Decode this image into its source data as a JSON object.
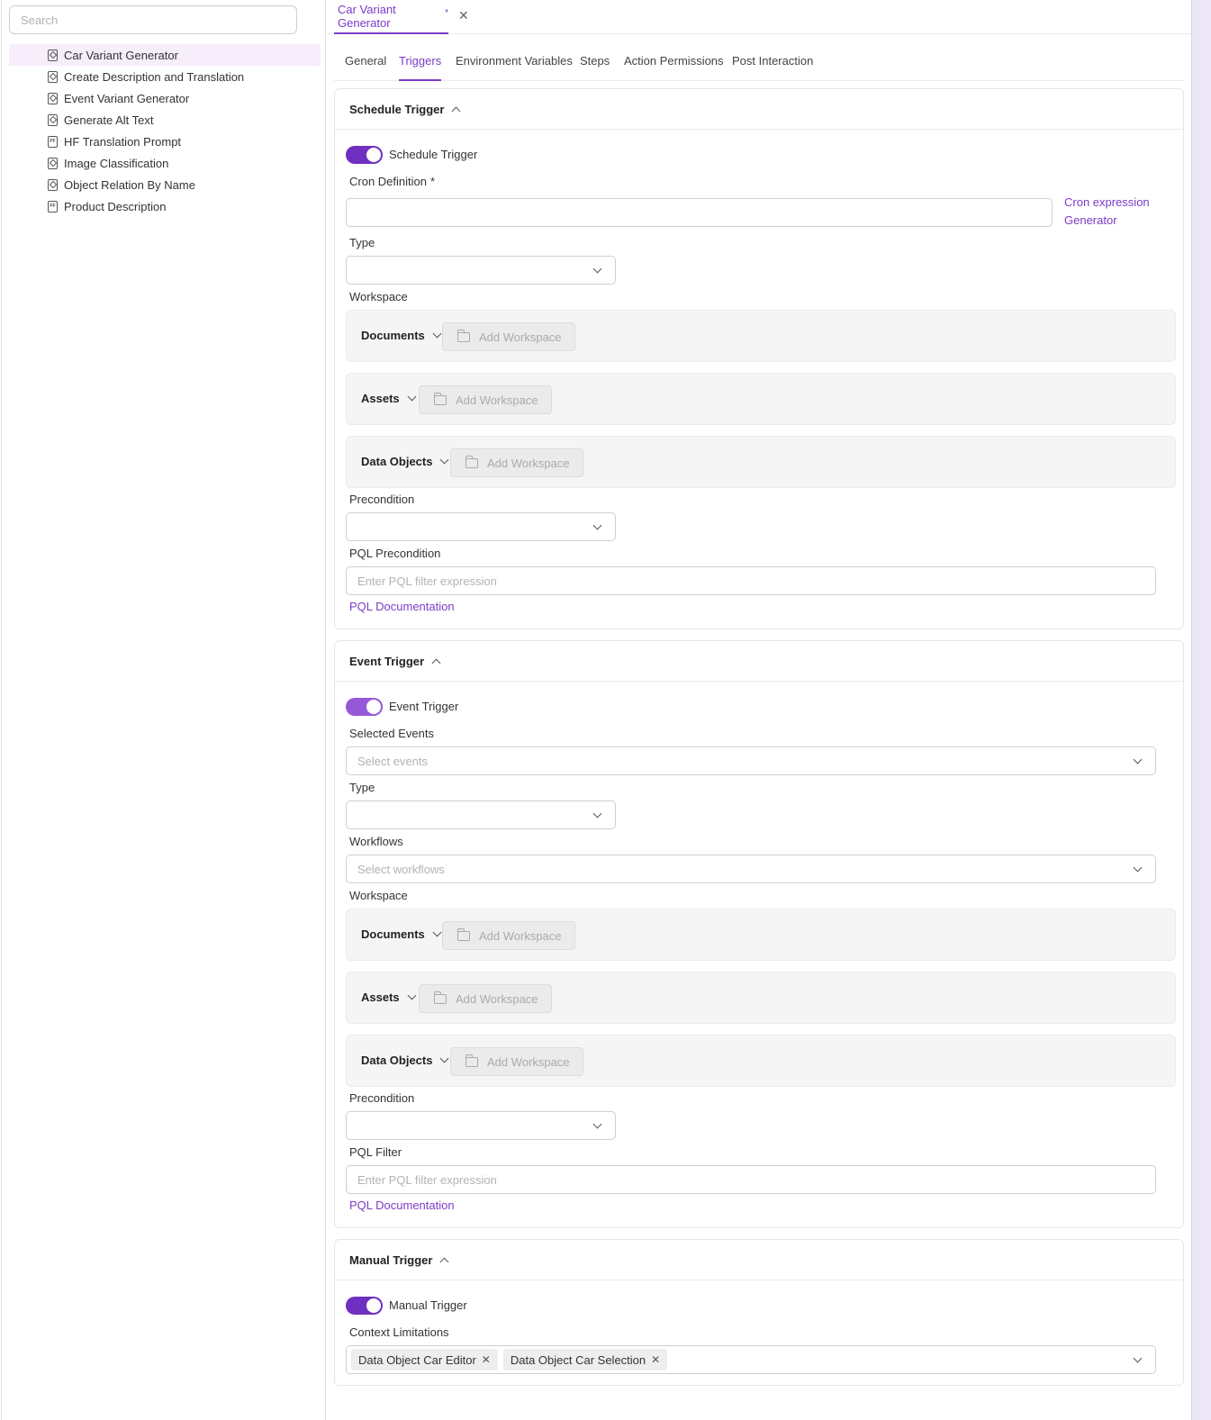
{
  "sidebar": {
    "search_placeholder": "Search",
    "items": [
      {
        "label": "Car Variant Generator",
        "icon": "gem"
      },
      {
        "label": "Create Description and Translation",
        "icon": "gem"
      },
      {
        "label": "Event Variant Generator",
        "icon": "gem"
      },
      {
        "label": "Generate Alt Text",
        "icon": "gem"
      },
      {
        "label": "HF Translation Prompt",
        "icon": "doc"
      },
      {
        "label": "Image Classification",
        "icon": "gem"
      },
      {
        "label": "Object Relation By Name",
        "icon": "gem"
      },
      {
        "label": "Product Description",
        "icon": "doc"
      }
    ]
  },
  "doc_tab": {
    "title": "Car Variant Generator",
    "modified_mark": "*"
  },
  "subtabs": [
    "General",
    "Triggers",
    "Environment Variables",
    "Steps",
    "Action Permissions",
    "Post Interaction"
  ],
  "schedule": {
    "title": "Schedule Trigger",
    "toggle_label": "Schedule Trigger",
    "cron_label": "Cron Definition",
    "required_mark": "*",
    "cron_link_line1": "Cron expression",
    "cron_link_line2": "Generator",
    "type_label": "Type",
    "workspace_label": "Workspace",
    "precondition_label": "Precondition",
    "pql_label": "PQL Precondition",
    "pql_placeholder": "Enter PQL filter expression",
    "pql_doc_link": "PQL Documentation"
  },
  "event": {
    "title": "Event Trigger",
    "toggle_label": "Event Trigger",
    "events_label": "Selected Events",
    "events_placeholder": "Select events",
    "type_label": "Type",
    "workflows_label": "Workflows",
    "workflows_placeholder": "Select workflows",
    "workspace_label": "Workspace",
    "precondition_label": "Precondition",
    "pql_label": "PQL Filter",
    "pql_placeholder": "Enter PQL filter expression",
    "pql_doc_link": "PQL Documentation"
  },
  "workspace_boxes": {
    "documents": "Documents",
    "assets": "Assets",
    "data_objects": "Data Objects",
    "add_label": "Add Workspace"
  },
  "manual": {
    "title": "Manual Trigger",
    "toggle_label": "Manual Trigger",
    "context_label": "Context Limitations",
    "chips": [
      "Data Object Car Editor",
      "Data Object Car Selection"
    ]
  },
  "colors": {
    "accent": "#7b3cc8",
    "toggle": "#6f2fc0"
  }
}
